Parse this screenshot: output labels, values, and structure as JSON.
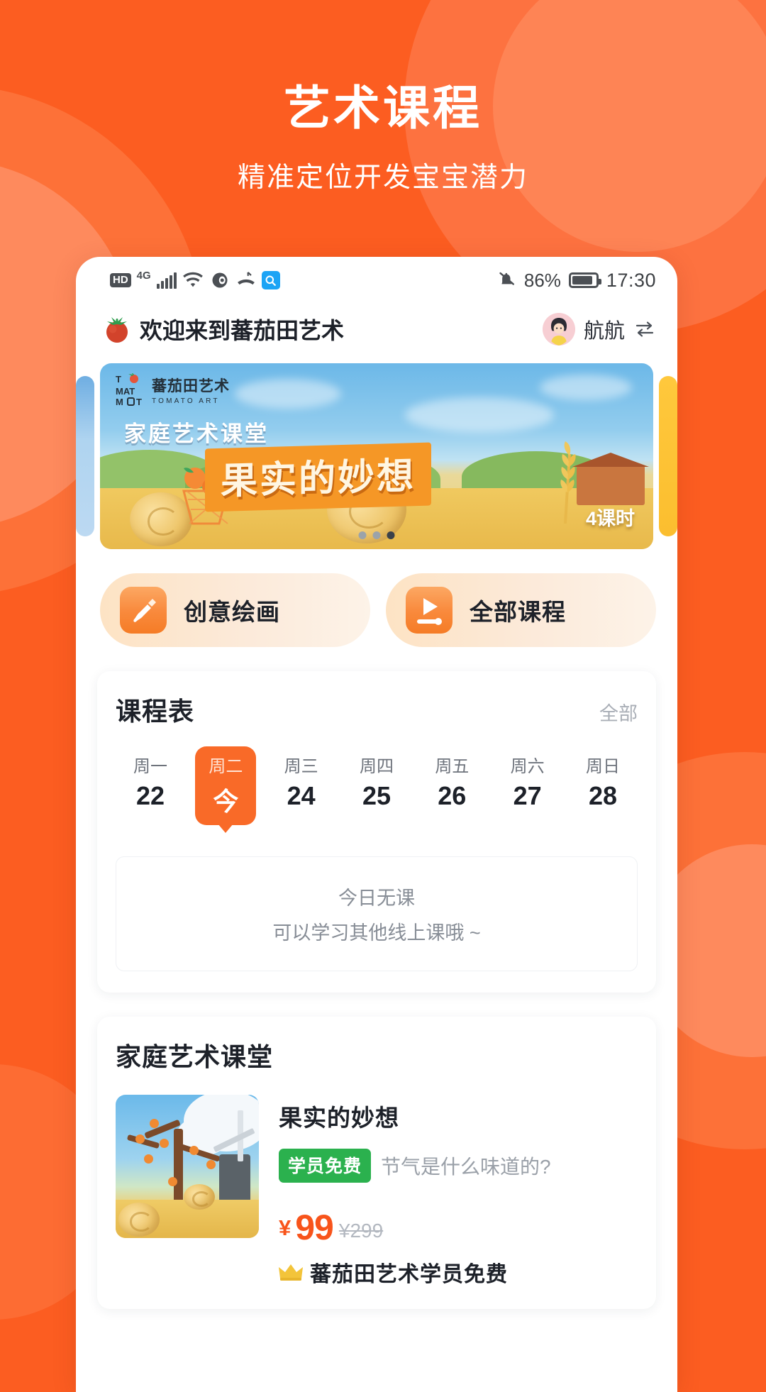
{
  "hero": {
    "title": "艺术课程",
    "subtitle": "精准定位开发宝宝潜力"
  },
  "colors": {
    "brand_orange": "#FC5D21",
    "accent_orange": "#F96A28",
    "price_red": "#F8541B",
    "badge_green": "#2BB14E",
    "text_dark": "#1d2129",
    "text_muted": "#9AA0A8"
  },
  "statusbar": {
    "hd_label": "HD",
    "network_label": "4G",
    "battery_percent": "86%",
    "time": "17:30",
    "icons": [
      "hd-icon",
      "signal-4g-icon",
      "signal-bars-icon",
      "wifi-icon",
      "eye-icon",
      "missed-call-icon",
      "search-icon",
      "mute-bell-icon",
      "battery-icon"
    ]
  },
  "appbar": {
    "logo_icon": "tomato-icon",
    "welcome": "欢迎来到蕃茄田艺术",
    "user_name": "航航",
    "avatar_icon": "avatar",
    "switch_icon": "switch-account-icon"
  },
  "banner": {
    "logo_mark": "T\nMAT\nM T",
    "logo_cn": "蕃茄田艺术",
    "logo_en": "TOMATO ART",
    "kicker": "家庭艺术课堂",
    "headline": "果实的妙想",
    "hours": "4课时",
    "dots_total": 3,
    "dots_active_index": 2
  },
  "quick_actions": [
    {
      "label": "创意绘画",
      "icon": "paintbrush-icon"
    },
    {
      "label": "全部课程",
      "icon": "play-video-icon"
    }
  ],
  "schedule": {
    "title": "课程表",
    "more_label": "全部",
    "days": [
      {
        "weekday": "周一",
        "date": "22",
        "active": false
      },
      {
        "weekday": "周二",
        "date": "今",
        "active": true
      },
      {
        "weekday": "周三",
        "date": "24",
        "active": false
      },
      {
        "weekday": "周四",
        "date": "25",
        "active": false
      },
      {
        "weekday": "周五",
        "date": "26",
        "active": false
      },
      {
        "weekday": "周六",
        "date": "27",
        "active": false
      },
      {
        "weekday": "周日",
        "date": "28",
        "active": false
      }
    ],
    "empty_line1": "今日无课",
    "empty_line2": "可以学习其他线上课哦 ~"
  },
  "home_class": {
    "title": "家庭艺术课堂",
    "course": {
      "name": "果实的妙想",
      "badge": "学员免费",
      "desc": "节气是什么味道的?",
      "currency": "¥",
      "price": "99",
      "original_price": "¥299",
      "vip_icon": "crown-icon",
      "vip_note": "蕃茄田艺术学员免费",
      "thumb_icon": "persimmon-tree-thumb"
    }
  }
}
